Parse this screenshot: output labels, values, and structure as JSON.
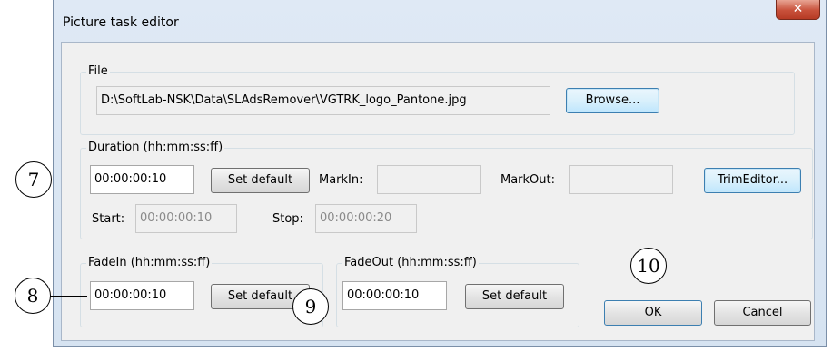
{
  "window": {
    "title": "Picture task editor",
    "close_glyph": "✕"
  },
  "file": {
    "legend": "File",
    "path": "D:\\SoftLab-NSK\\Data\\SLAdsRemover\\VGTRK_logo_Pantone.jpg",
    "browse": "Browse..."
  },
  "duration": {
    "legend": "Duration (hh:mm:ss:ff)",
    "value": "00:00:00:10",
    "set_default": "Set default",
    "markin_label": "MarkIn:",
    "markin_value": "",
    "markout_label": "MarkOut:",
    "markout_value": "",
    "trim": "TrimEditor...",
    "start_label": "Start:",
    "start_value": "00:00:00:10",
    "stop_label": "Stop:",
    "stop_value": "00:00:00:20"
  },
  "fadein": {
    "legend": "FadeIn (hh:mm:ss:ff)",
    "value": "00:00:00:10",
    "set_default": "Set default"
  },
  "fadeout": {
    "legend": "FadeOut (hh:mm:ss:ff)",
    "value": "00:00:00:10",
    "set_default": "Set default"
  },
  "buttons": {
    "ok": "OK",
    "cancel": "Cancel"
  },
  "callouts": {
    "c7": "7",
    "c8": "8",
    "c9": "9",
    "c10": "10"
  },
  "colors": {
    "close_button": "#c8503a",
    "focus_border": "#3c7fb1",
    "dialog_bg": "#f0f0f0"
  }
}
